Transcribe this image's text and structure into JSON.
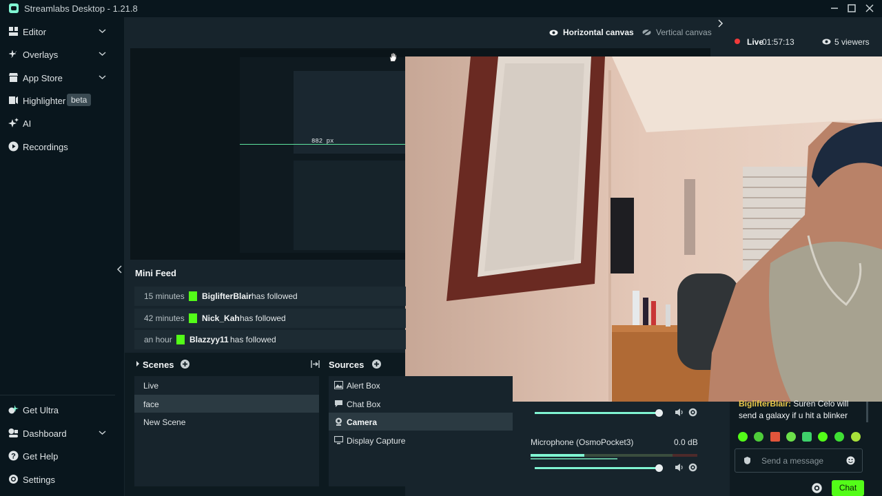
{
  "window": {
    "title": "Streamlabs Desktop - 1.21.8"
  },
  "nav": {
    "items": [
      {
        "label": "Editor",
        "icon": "editor-icon",
        "chevron": true
      },
      {
        "label": "Overlays",
        "icon": "overlays-icon",
        "chevron": true
      },
      {
        "label": "App Store",
        "icon": "store-icon",
        "chevron": true
      },
      {
        "label": "Highlighter",
        "icon": "highlighter-icon",
        "badge": "beta"
      },
      {
        "label": "AI",
        "icon": "sparkle-icon"
      },
      {
        "label": "Recordings",
        "icon": "play-circle-icon"
      }
    ],
    "bottom_items": [
      {
        "label": "Get Ultra",
        "icon": "ultra-icon"
      },
      {
        "label": "Dashboard",
        "icon": "dashboard-icon",
        "chevron": true
      },
      {
        "label": "Get Help",
        "icon": "help-icon"
      },
      {
        "label": "Settings",
        "icon": "gear-icon"
      }
    ]
  },
  "canvas": {
    "horizontal_label": "Horizontal canvas",
    "vertical_label": "Vertical canvas"
  },
  "stream": {
    "live_label": "Live",
    "live_time": "01:57:13",
    "viewers": "5 viewers"
  },
  "preview": {
    "measure_label": "882 px"
  },
  "minifeed": {
    "title": "Mini Feed",
    "rows": [
      {
        "time": "15 minutes",
        "user": "BiglifterBlair",
        "action": "has followed"
      },
      {
        "time": "42 minutes",
        "user": "Nick_Kah",
        "action": "has followed"
      },
      {
        "time": "an hour",
        "user": "Blazzyy11",
        "action": "has followed"
      }
    ]
  },
  "scenes": {
    "title": "Scenes",
    "items": [
      "Live",
      "face",
      "New Scene"
    ],
    "selected": "face"
  },
  "sources": {
    "title": "Sources",
    "items": [
      {
        "label": "Alert Box",
        "icon": "image-icon"
      },
      {
        "label": "Chat Box",
        "icon": "chat-icon"
      },
      {
        "label": "Camera",
        "icon": "camera-icon"
      },
      {
        "label": "Display Capture",
        "icon": "monitor-icon"
      }
    ],
    "selected": "Camera"
  },
  "mixer": {
    "microphone_label": "Microphone (OsmoPocket3)",
    "microphone_db": "0.0 dB"
  },
  "chat": {
    "message_user": "BiglifterBlair:",
    "message_text": "Suren Celo will send a galaxy if u hit a blinker",
    "input_placeholder": "Send a message",
    "send_label": "Chat"
  },
  "colors": {
    "accent": "#80f5d2",
    "kick_green": "#53fc18",
    "live_red": "#f23a3a"
  }
}
